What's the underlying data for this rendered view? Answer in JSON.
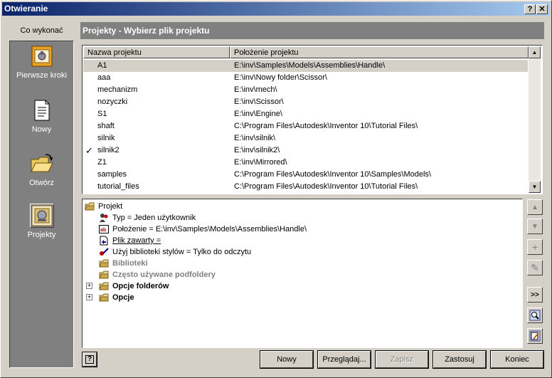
{
  "window": {
    "title": "Otwieranie",
    "help_glyph": "?",
    "close_glyph": "✕"
  },
  "sidebar": {
    "header": "Co wykonać",
    "items": [
      {
        "label": "Pierwsze kroki",
        "icon": "getting-started-icon"
      },
      {
        "label": "Nowy",
        "icon": "new-document-icon"
      },
      {
        "label": "Otwórz",
        "icon": "open-folder-icon"
      },
      {
        "label": "Projekty",
        "icon": "projects-icon"
      }
    ]
  },
  "panel": {
    "title": "Projekty - Wybierz plik projektu"
  },
  "projects_table": {
    "columns": [
      "Nazwa projektu",
      "Położenie projektu"
    ],
    "active_marker": "✓",
    "rows": [
      {
        "name": "A1",
        "location": "E:\\inv\\Samples\\Models\\Assemblies\\Handle\\"
      },
      {
        "name": "aaa",
        "location": "E:\\inv\\Nowy folder\\Scissor\\"
      },
      {
        "name": "mechanizm",
        "location": "E:\\inv\\mech\\"
      },
      {
        "name": "nozyczki",
        "location": "E:\\inv\\Scissor\\"
      },
      {
        "name": "S1",
        "location": "E:\\inv\\Engine\\"
      },
      {
        "name": "shaft",
        "location": "C:\\Program Files\\Autodesk\\Inventor 10\\Tutorial Files\\"
      },
      {
        "name": "silnik",
        "location": "E:\\inv\\silnik\\"
      },
      {
        "name": "silnik2",
        "location": "E:\\inv\\silnik2\\"
      },
      {
        "name": "Z1",
        "location": "E:\\inv\\Mirrored\\"
      },
      {
        "name": "samples",
        "location": "C:\\Program Files\\Autodesk\\Inventor 10\\Samples\\Models\\"
      },
      {
        "name": "tutorial_files",
        "location": "C:\\Program Files\\Autodesk\\Inventor 10\\Tutorial Files\\"
      }
    ]
  },
  "tree": {
    "root": "Projekt",
    "items": [
      {
        "label": "Typ = Jeden użytkownik"
      },
      {
        "label": "Położenie = E:\\inv\\Samples\\Models\\Assemblies\\Handle\\"
      },
      {
        "label": "Plik zawarty ="
      },
      {
        "label": "Użyj biblioteki stylów = Tylko do odczytu"
      },
      {
        "label": "Biblioteki"
      },
      {
        "label": "Często używane podfoldery"
      },
      {
        "label": "Opcje folderów"
      },
      {
        "label": "Opcje"
      }
    ],
    "expander_glyph": "+"
  },
  "side_buttons": {
    "up": "▲",
    "down": "▼",
    "add": "+",
    "edit": "✎",
    "expand": ">>"
  },
  "buttons": {
    "help": "?",
    "new": "Nowy",
    "browse": "Przeglądaj...",
    "save": "Zapisz",
    "apply": "Zastosuj",
    "finish": "Koniec"
  }
}
